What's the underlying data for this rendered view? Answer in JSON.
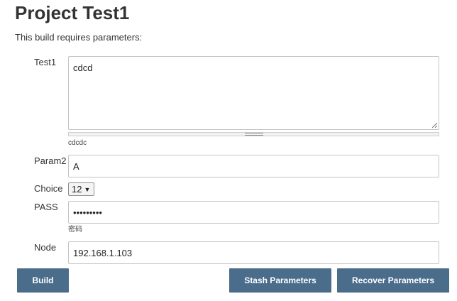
{
  "header": {
    "title": "Project Test1",
    "subtitle": "This build requires parameters:"
  },
  "params": {
    "test1": {
      "label": "Test1",
      "value": "cdcd",
      "description": "cdcdc"
    },
    "param2": {
      "label": "Param2",
      "value": "A"
    },
    "choice": {
      "label": "Choice",
      "selected": "12"
    },
    "pass": {
      "label": "PASS",
      "value": "•••••••••",
      "description": "密码"
    },
    "node": {
      "label": "Node",
      "value": "192.168.1.103"
    }
  },
  "actions": {
    "build_label": "Build",
    "stash_label": "Stash Parameters",
    "recover_label": "Recover Parameters"
  },
  "colors": {
    "button_bg": "#4b6d8c",
    "button_text": "#ffffff",
    "text": "#333333"
  }
}
